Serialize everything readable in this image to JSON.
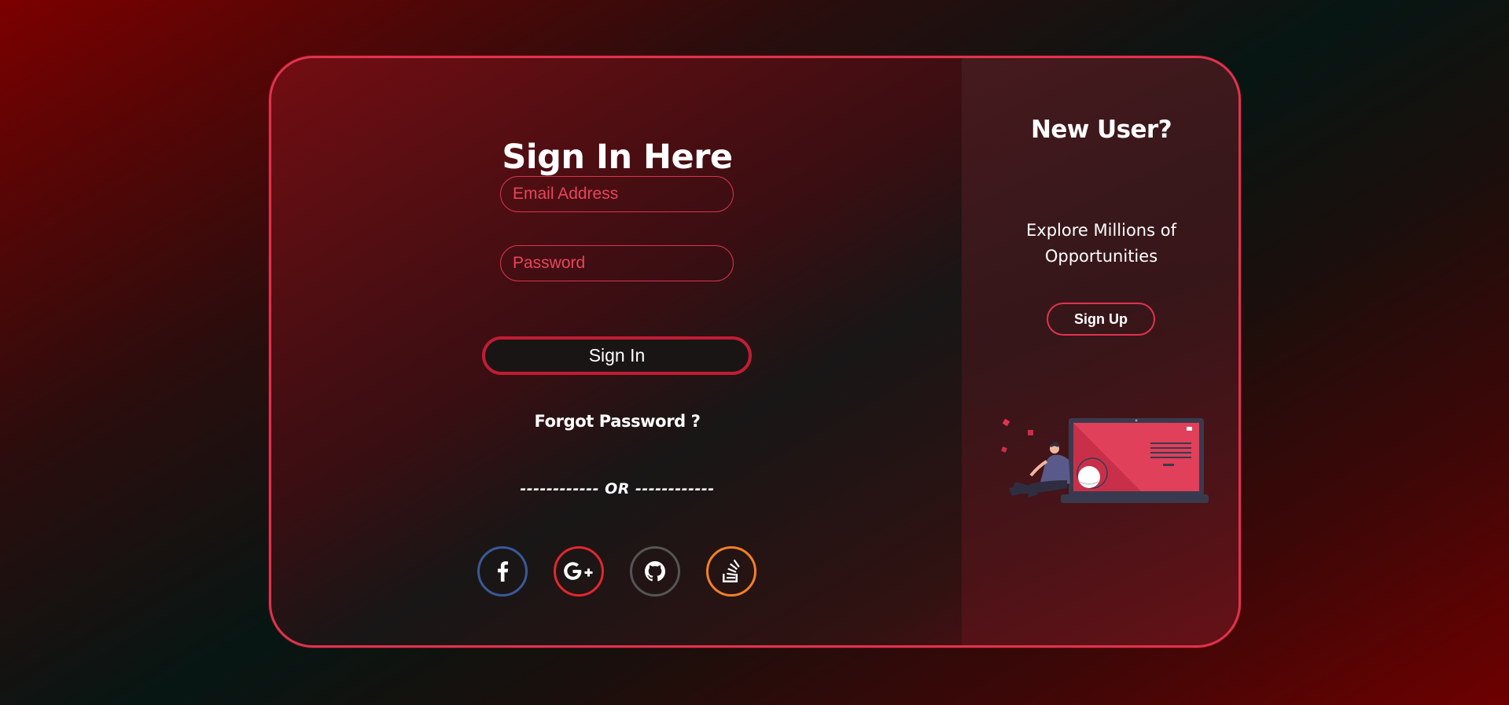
{
  "signin": {
    "title": "Sign In Here",
    "email_placeholder": "Email Address",
    "password_placeholder": "Password",
    "button_label": "Sign In",
    "forgot_label": "Forgot Password ?",
    "or_divider": "------------ OR ------------",
    "social": [
      {
        "name": "facebook-icon",
        "color": "#3b5998"
      },
      {
        "name": "google-plus-icon",
        "color": "#e3272e"
      },
      {
        "name": "github-icon",
        "color": "#555555"
      },
      {
        "name": "stack-overflow-icon",
        "color": "#f48024"
      }
    ]
  },
  "signup_panel": {
    "title": "New User?",
    "tagline": "Explore Millions of Opportunities",
    "button_label": "Sign Up",
    "illustration": "person-leaning-on-laptop-illustration"
  },
  "colors": {
    "accent": "#e0334f",
    "accent_dark": "#c21c33",
    "text": "#ffffff",
    "placeholder": "#e8455c"
  }
}
